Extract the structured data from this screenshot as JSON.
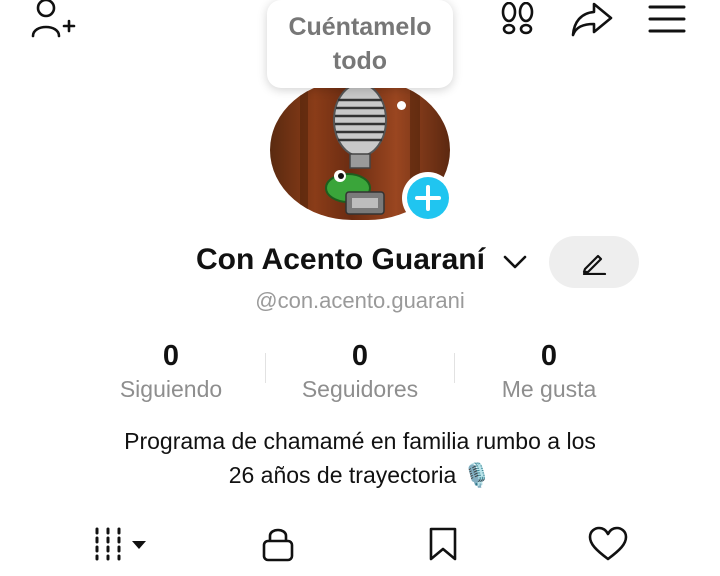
{
  "bubble": {
    "line1": "Cuéntamelo",
    "line2": "todo"
  },
  "profile": {
    "name": "Con Acento Guaraní",
    "handle": "@con.acento.guarani",
    "bio_line1": "Programa de chamamé en familia rumbo a los",
    "bio_line2": "26 años de trayectoria 🎙️"
  },
  "stats": [
    {
      "value": "0",
      "label": "Siguiendo"
    },
    {
      "value": "0",
      "label": "Seguidores"
    },
    {
      "value": "0",
      "label": "Me gusta"
    }
  ],
  "colors": {
    "accent": "#20c5f0",
    "muted": "#8e8e8e",
    "edit_bg": "#eeeeee"
  },
  "icons": {
    "top": [
      "add-user-icon",
      "footprints-icon",
      "share-icon",
      "menu-icon"
    ],
    "tabs": [
      "grid-icon",
      "lock-icon",
      "bookmark-icon",
      "heart-icon"
    ]
  }
}
